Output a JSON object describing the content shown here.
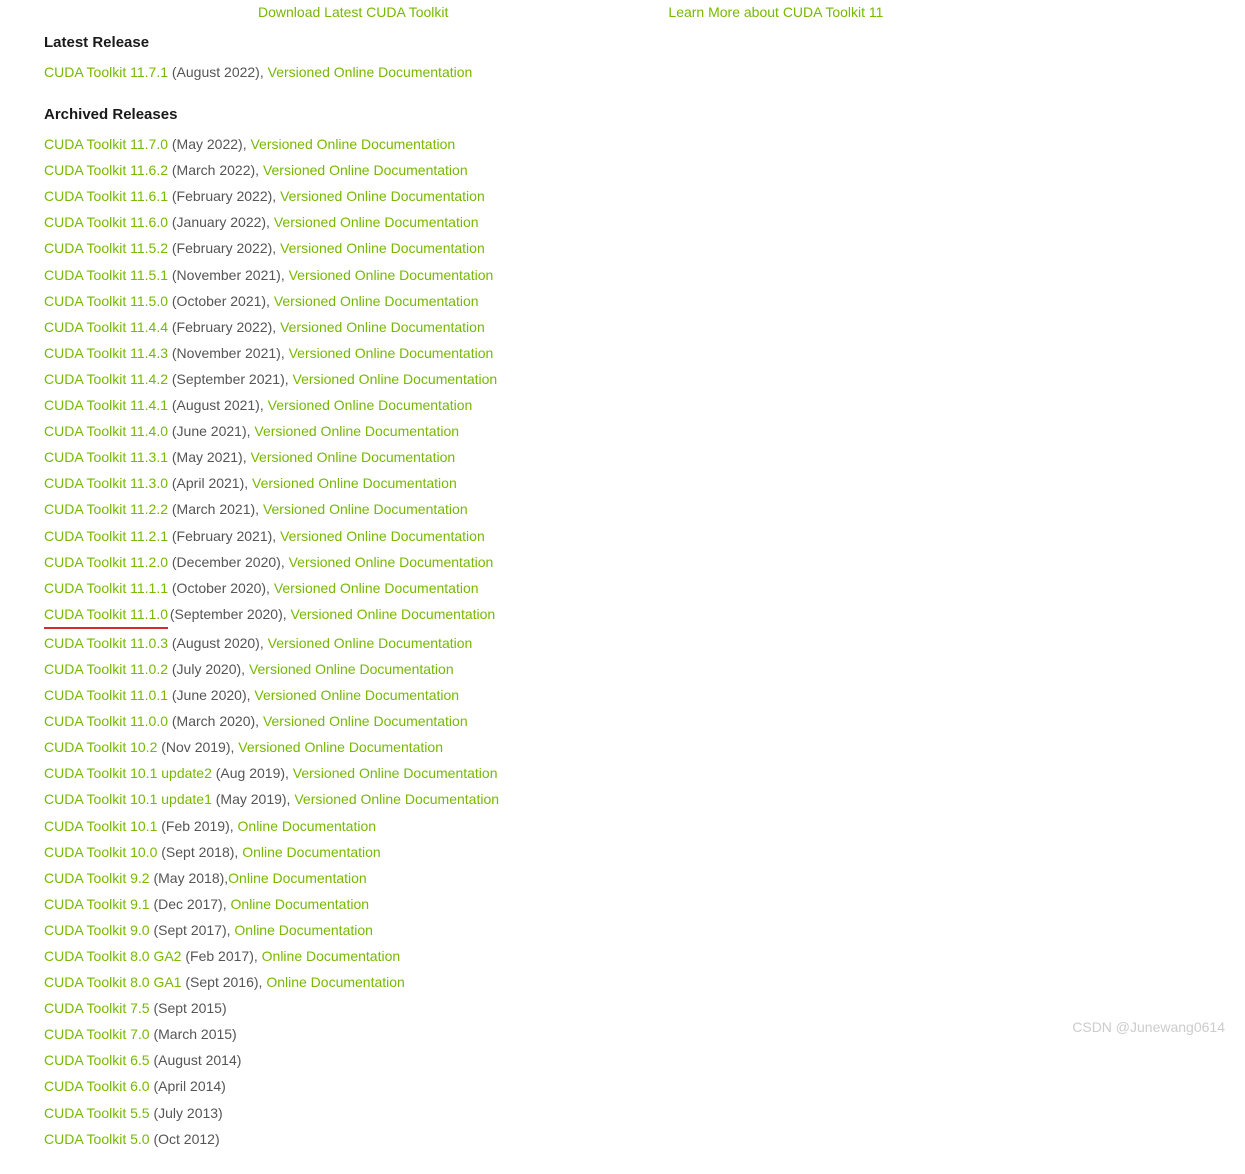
{
  "top": {
    "download": "Download Latest CUDA Toolkit",
    "learn": "Learn More about CUDA Toolkit 11"
  },
  "headings": {
    "latest": "Latest Release",
    "archived": "Archived Releases"
  },
  "latest": {
    "name": "CUDA Toolkit 11.7.1",
    "date": " (August 2022), ",
    "doc": "Versioned Online Documentation"
  },
  "archived": [
    {
      "name": "CUDA Toolkit 11.7.0",
      "date": " (May 2022), ",
      "doc": "Versioned Online Documentation"
    },
    {
      "name": "CUDA Toolkit 11.6.2",
      "date": " (March 2022), ",
      "doc": "Versioned Online Documentation"
    },
    {
      "name": "CUDA Toolkit 11.6.1",
      "date": " (February 2022), ",
      "doc": "Versioned Online Documentation"
    },
    {
      "name": "CUDA Toolkit 11.6.0",
      "date": " (January 2022), ",
      "doc": "Versioned Online Documentation"
    },
    {
      "name": "CUDA Toolkit 11.5.2",
      "date": " (February 2022), ",
      "doc": "Versioned Online Documentation"
    },
    {
      "name": "CUDA Toolkit 11.5.1",
      "date": " (November 2021), ",
      "doc": "Versioned Online Documentation"
    },
    {
      "name": "CUDA Toolkit 11.5.0",
      "date": " (October 2021), ",
      "doc": "Versioned Online Documentation"
    },
    {
      "name": "CUDA Toolkit 11.4.4",
      "date": " (February 2022), ",
      "doc": "Versioned Online Documentation"
    },
    {
      "name": "CUDA Toolkit 11.4.3",
      "date": " (November 2021), ",
      "doc": "Versioned Online Documentation"
    },
    {
      "name": "CUDA Toolkit 11.4.2",
      "date": " (September 2021), ",
      "doc": "Versioned Online Documentation"
    },
    {
      "name": "CUDA Toolkit 11.4.1",
      "date": " (August 2021), ",
      "doc": "Versioned Online Documentation"
    },
    {
      "name": "CUDA Toolkit 11.4.0",
      "date": " (June 2021), ",
      "doc": "Versioned Online Documentation"
    },
    {
      "name": "CUDA Toolkit 11.3.1",
      "date": " (May 2021), ",
      "doc": "Versioned Online Documentation"
    },
    {
      "name": "CUDA Toolkit 11.3.0",
      "date": " (April 2021), ",
      "doc": "Versioned Online Documentation"
    },
    {
      "name": "CUDA Toolkit 11.2.2",
      "date": " (March 2021), ",
      "doc": "Versioned Online Documentation"
    },
    {
      "name": "CUDA Toolkit 11.2.1",
      "date": " (February 2021), ",
      "doc": "Versioned Online Documentation"
    },
    {
      "name": "CUDA Toolkit 11.2.0",
      "date": " (December 2020), ",
      "doc": "Versioned Online Documentation"
    },
    {
      "name": "CUDA Toolkit 11.1.1",
      "date": " (October 2020), ",
      "doc": "Versioned Online Documentation"
    },
    {
      "name": "CUDA Toolkit 11.1.0",
      "date": " (September 2020), ",
      "doc": "Versioned Online Documentation",
      "underline": true
    },
    {
      "name": "CUDA Toolkit 11.0.3",
      "date": " (August 2020), ",
      "doc": "Versioned Online Documentation"
    },
    {
      "name": "CUDA Toolkit 11.0.2",
      "date": " (July 2020), ",
      "doc": "Versioned Online Documentation"
    },
    {
      "name": "CUDA Toolkit 11.0.1",
      "date": " (June 2020), ",
      "doc": "Versioned Online Documentation"
    },
    {
      "name": "CUDA Toolkit 11.0.0",
      "date": " (March 2020), ",
      "doc": "Versioned Online Documentation"
    },
    {
      "name": "CUDA Toolkit 10.2",
      "date": " (Nov 2019), ",
      "doc": "Versioned Online Documentation"
    },
    {
      "name": "CUDA Toolkit 10.1 update2",
      "date": " (Aug 2019), ",
      "doc": "Versioned Online Documentation"
    },
    {
      "name": "CUDA Toolkit 10.1 update1",
      "date": " (May 2019), ",
      "doc": "Versioned Online Documentation"
    },
    {
      "name": "CUDA Toolkit 10.1",
      "date": " (Feb 2019), ",
      "doc": "Online Documentation"
    },
    {
      "name": "CUDA Toolkit 10.0",
      "date": " (Sept 2018), ",
      "doc": "Online Documentation"
    },
    {
      "name": "CUDA Toolkit 9.2",
      "date": " (May 2018),",
      "doc": "Online Documentation"
    },
    {
      "name": "CUDA Toolkit 9.1",
      "date": " (Dec 2017), ",
      "doc": "Online Documentation"
    },
    {
      "name": "CUDA Toolkit 9.0",
      "date": " (Sept 2017), ",
      "doc": "Online Documentation"
    },
    {
      "name": "CUDA Toolkit 8.0 GA2",
      "date": " (Feb 2017), ",
      "doc": "Online Documentation"
    },
    {
      "name": "CUDA Toolkit 8.0 GA1",
      "date": " (Sept 2016), ",
      "doc": "Online Documentation"
    },
    {
      "name": "CUDA Toolkit 7.5",
      "date": " (Sept 2015)",
      "doc": ""
    },
    {
      "name": "CUDA Toolkit 7.0",
      "date": " (March 2015)",
      "doc": ""
    },
    {
      "name": "CUDA Toolkit 6.5",
      "date": " (August 2014)",
      "doc": ""
    },
    {
      "name": "CUDA Toolkit 6.0",
      "date": " (April 2014)",
      "doc": ""
    },
    {
      "name": "CUDA Toolkit 5.5",
      "date": " (July 2013)",
      "doc": ""
    },
    {
      "name": "CUDA Toolkit 5.0",
      "date": " (Oct 2012)",
      "doc": ""
    }
  ],
  "watermark": "CSDN @Junewang0614"
}
